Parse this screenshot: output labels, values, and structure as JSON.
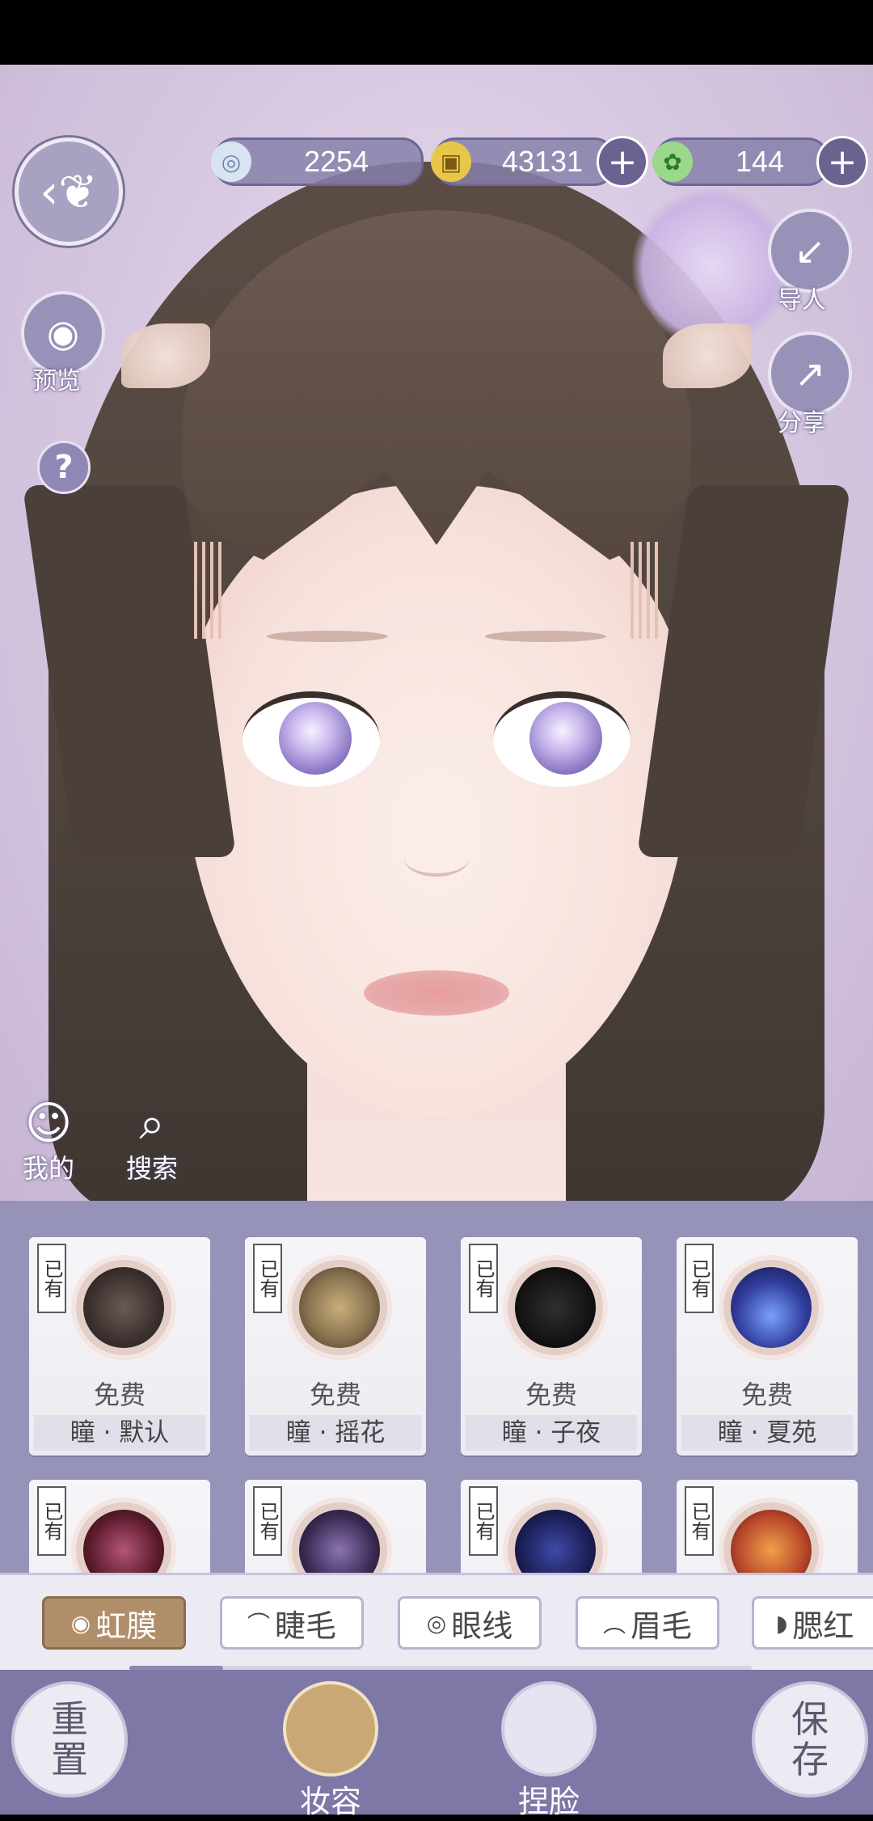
{
  "currencies": [
    {
      "icon": "jade-coin-icon",
      "value": "2254",
      "color": "#a9c8e6"
    },
    {
      "icon": "gold-coin-icon",
      "value": "43131",
      "color": "#e8c64b"
    },
    {
      "icon": "green-token-icon",
      "value": "144",
      "color": "#7ccf6f"
    }
  ],
  "hud": {
    "preview_label": "预览",
    "import_label": "导人",
    "share_label": "分享",
    "my_label": "我的",
    "search_label": "搜索",
    "help_symbol": "?"
  },
  "items": [
    {
      "owned": "已有",
      "price": "免费",
      "name": "瞳 · 默认",
      "color": "#3b302e"
    },
    {
      "owned": "已有",
      "price": "免费",
      "name": "瞳 · 摇花",
      "color": "#8a7350"
    },
    {
      "owned": "已有",
      "price": "免费",
      "name": "瞳 · 子夜",
      "color": "#141414"
    },
    {
      "owned": "已有",
      "price": "免费",
      "name": "瞳 · 夏苑",
      "color": "#2f3b9a"
    },
    {
      "owned": "已有",
      "price": "",
      "name": "",
      "color": "#5c1b2b"
    },
    {
      "owned": "已有",
      "price": "",
      "name": "",
      "color": "#3a2a52"
    },
    {
      "owned": "已有",
      "price": "",
      "name": "",
      "color": "#1b1f55"
    },
    {
      "owned": "已有",
      "price": "",
      "name": "",
      "color": "#b7462a"
    }
  ],
  "tabs": [
    "虹膜",
    "睫毛",
    "眼线",
    "眉毛",
    "腮红"
  ],
  "tab_progress": 0.15,
  "bottom": {
    "reset": "重置",
    "makeup": "妆容",
    "face": "捏脸",
    "save": "保存"
  }
}
